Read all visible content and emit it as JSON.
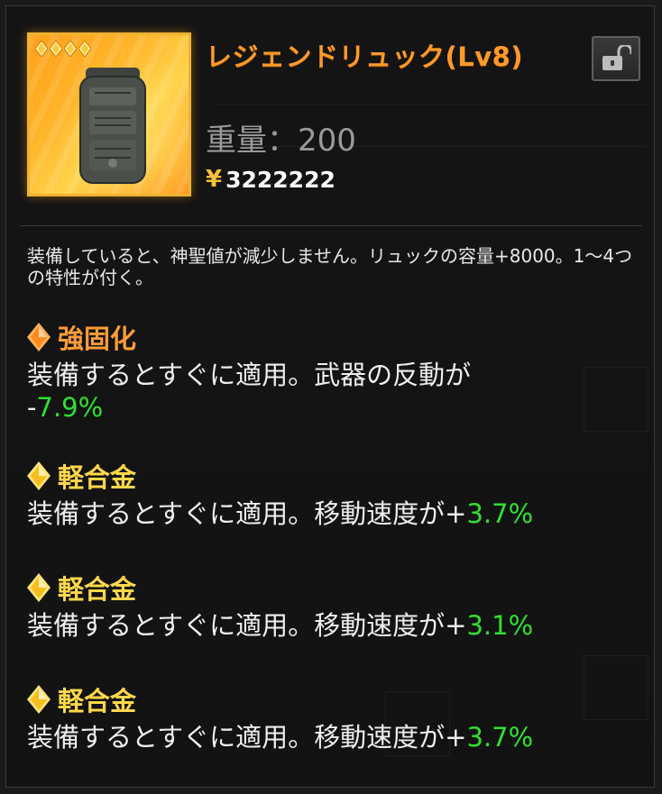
{
  "item": {
    "name": "レジェンドリュック(Lv8)",
    "rarity_stars": 4,
    "weight_label": "重量：200",
    "currency_symbol": "¥",
    "price": "3222222",
    "description": "装備していると、神聖値が減少しません。リュックの容量+8000。1～4つの特性が付く。"
  },
  "traits": [
    {
      "name": "強固化",
      "gem_color": "orange",
      "text": "装備するとすぐに適用。武器の反動が",
      "sign": "-",
      "value": "7.9%",
      "wrap": true
    },
    {
      "name": "軽合金",
      "gem_color": "gold",
      "text": "装備するとすぐに適用。移動速度が",
      "sign": "+",
      "value": "3.7%",
      "wrap": false
    },
    {
      "name": "軽合金",
      "gem_color": "gold",
      "text": "装備するとすぐに適用。移動速度が",
      "sign": "+",
      "value": "3.1%",
      "wrap": false
    },
    {
      "name": "軽合金",
      "gem_color": "gold",
      "text": "装備するとすぐに適用。移動速度が",
      "sign": "+",
      "value": "3.7%",
      "wrap": false
    }
  ],
  "colors": {
    "title": "#ff9a2a",
    "frame": "#f0b230",
    "positive": "#2fe12f",
    "orange_gem": "#ff9c3a",
    "gold_gem": "#ffd84a"
  },
  "icons": {
    "lock": "padlock-icon",
    "star": "diamond-star-icon",
    "gem": "diamond-gem-icon"
  }
}
